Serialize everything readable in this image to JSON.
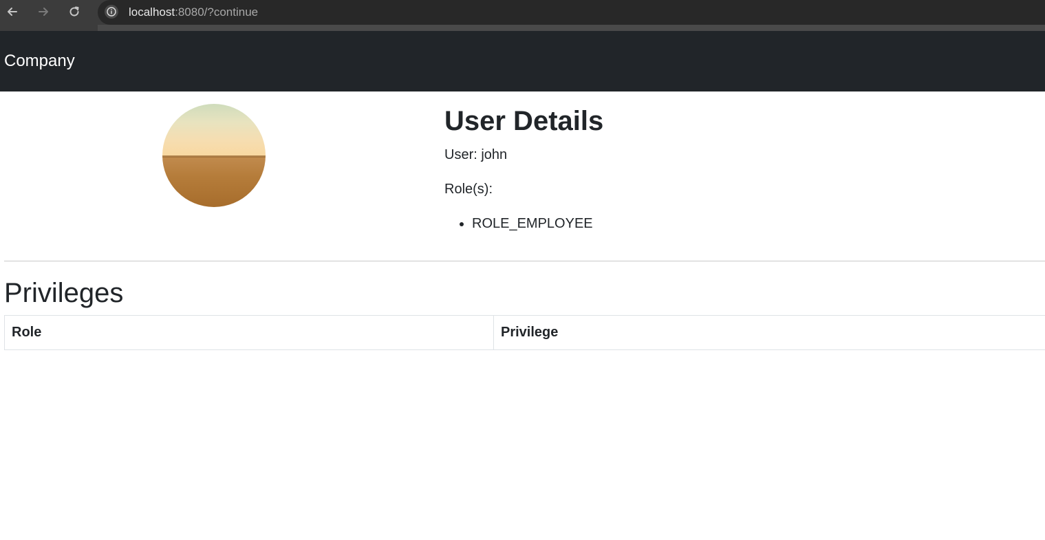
{
  "browser": {
    "url_host": "localhost",
    "url_rest": ":8080/?continue",
    "back_icon": "arrow-left-icon",
    "forward_icon": "arrow-right-icon",
    "reload_icon": "reload-icon",
    "info_icon": "info-icon"
  },
  "navbar": {
    "brand": "Company",
    "background": "#212529"
  },
  "profile": {
    "avatar": "landscape-avatar-image",
    "title": "User Details",
    "user_line": "User: john",
    "roles_label": "Role(s):",
    "roles": [
      "ROLE_EMPLOYEE"
    ]
  },
  "privileges": {
    "title": "Privileges",
    "columns": [
      "Role",
      "Privilege"
    ],
    "rows": []
  }
}
